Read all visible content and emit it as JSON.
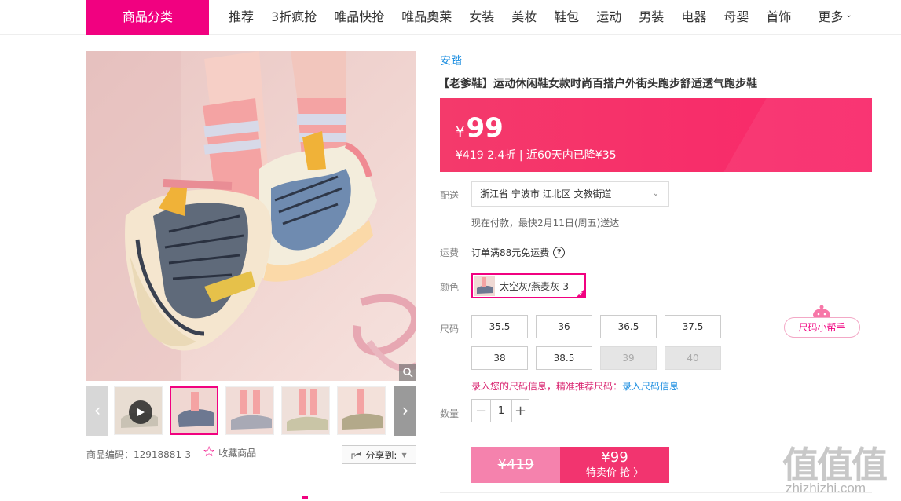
{
  "nav": {
    "category_button": "商品分类",
    "links": [
      "推荐",
      "3折疯抢",
      "唯品快抢",
      "唯品奥莱",
      "女装",
      "美妆",
      "鞋包",
      "运动",
      "男装",
      "电器",
      "母婴",
      "首饰"
    ],
    "more": "更多"
  },
  "gallery": {
    "thumb_count": 5,
    "active_index": 1
  },
  "product_meta": {
    "sku_label": "商品编码：12918881-3",
    "favorite": "收藏商品",
    "share": "分享到:"
  },
  "product": {
    "brand": "安踏",
    "title": "【老爹鞋】运动休闲鞋女款时尚百搭户外街头跑步舒适透气跑步鞋"
  },
  "price": {
    "currency": "¥",
    "current": "99",
    "original": "¥419",
    "discount": "2.4折",
    "note": "| 近60天内已降¥35"
  },
  "delivery": {
    "label": "配送",
    "address": "浙江省 宁波市 江北区 文教街道",
    "note": "现在付款，最快2月11日(周五)送达"
  },
  "shipping": {
    "label": "运费",
    "text": "订单满88元免运费",
    "help": "?"
  },
  "color": {
    "label": "颜色",
    "selected": "太空灰/燕麦灰-3"
  },
  "sizes": {
    "label": "尺码",
    "options": [
      {
        "value": "35.5",
        "available": true
      },
      {
        "value": "36",
        "available": true
      },
      {
        "value": "36.5",
        "available": true
      },
      {
        "value": "37.5",
        "available": true
      },
      {
        "value": "38",
        "available": true
      },
      {
        "value": "38.5",
        "available": true
      },
      {
        "value": "39",
        "available": false
      },
      {
        "value": "40",
        "available": false
      }
    ],
    "helper": "尺码小帮手",
    "tip": "录入您的尺码信息，精准推荐尺码：",
    "tip_link": "录入尺码信息"
  },
  "quantity": {
    "label": "数量",
    "minus": "−",
    "value": "1",
    "plus": "+"
  },
  "buy": {
    "original_price": "¥419",
    "sale_price": "¥99",
    "action": "特卖价 抢 〉"
  },
  "watermark": {
    "glyphs": "值值值",
    "url": "zhizhizhi.com"
  },
  "colors": {
    "brand_pink": "#f10180",
    "price_red": "#f72e6a",
    "link_blue": "#1a8de0"
  }
}
